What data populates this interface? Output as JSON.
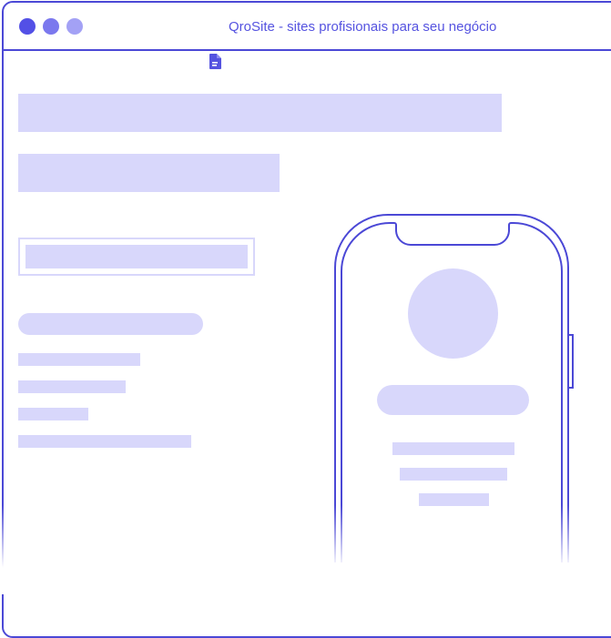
{
  "window": {
    "title": "QroSite - sites profisionais para seu negócio"
  },
  "icons": {
    "window_controls": [
      "close-dot-icon",
      "minimize-dot-icon",
      "maximize-dot-icon"
    ],
    "document": "document-icon"
  },
  "colors": {
    "accent": "#4b48d6",
    "title_text": "#5553e0",
    "dot_close": "#5350e6",
    "dot_minimize": "#7b78ee",
    "dot_maximize": "#a3a1f5",
    "placeholder": "#d8d7fb",
    "background": "#ffffff"
  }
}
